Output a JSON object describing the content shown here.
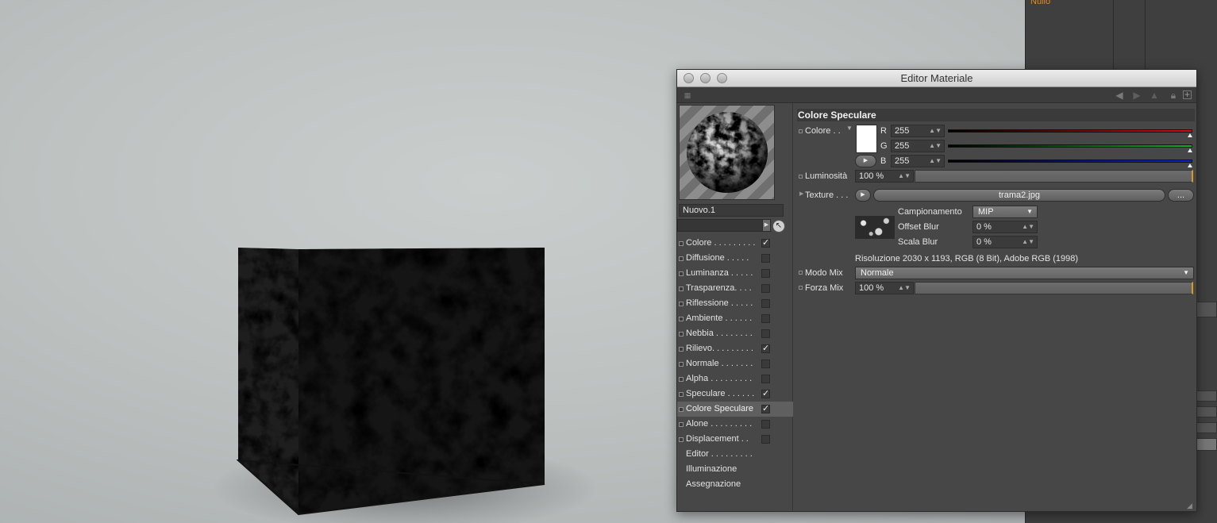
{
  "background_app": {
    "object_name": "Nullo"
  },
  "window": {
    "title": "Editor Materiale"
  },
  "material": {
    "name": "Nuovo.1"
  },
  "channels": [
    {
      "label": "Colore . . . . . . . . .",
      "checked": true
    },
    {
      "label": "Diffusione  . . . . .",
      "checked": false
    },
    {
      "label": "Luminanza . . . . .",
      "checked": false
    },
    {
      "label": "Trasparenza. . . .",
      "checked": false
    },
    {
      "label": "Riflessione . . . . .",
      "checked": false
    },
    {
      "label": "Ambiente . . . . . .",
      "checked": false
    },
    {
      "label": "Nebbia . . . . . . . .",
      "checked": false
    },
    {
      "label": "Rilievo. . . . . . . . .",
      "checked": true
    },
    {
      "label": "Normale . . . . . . .",
      "checked": false
    },
    {
      "label": "Alpha  . . . . . . . . .",
      "checked": false
    },
    {
      "label": "Speculare . . . . . .",
      "checked": true
    },
    {
      "label": "Colore Speculare",
      "checked": true,
      "selected": true
    },
    {
      "label": "Alone  . . . . . . . . .",
      "checked": false
    },
    {
      "label": "Displacement  . .",
      "checked": false
    }
  ],
  "extra_items": [
    {
      "label": "Editor  . . . . . . . . ."
    },
    {
      "label": "Illuminazione"
    },
    {
      "label": "Assegnazione"
    }
  ],
  "section": {
    "title": "Colore Speculare",
    "color_label": "Colore . .",
    "swatch_color": "#ffffff",
    "r_label": "R",
    "g_label": "G",
    "b_label": "B",
    "r": "255",
    "g": "255",
    "b": "255",
    "brightness_label": "Luminosità",
    "brightness": "100 %",
    "brightness_fraction": 1.0,
    "texture_label": "Texture . . .",
    "texture_file": "trama2.jpg",
    "texture_more": "...",
    "sampling_label": "Campionamento",
    "sampling_value": "MIP",
    "offset_blur_label": "Offset Blur",
    "offset_blur": "0 %",
    "scale_blur_label": "Scala Blur",
    "scale_blur": "0 %",
    "resolution": "Risoluzione 2030 x 1193, RGB (8 Bit), Adobe RGB (1998)",
    "mix_mode_label": "Modo Mix",
    "mix_mode": "Normale",
    "mix_strength_label": "Forza Mix",
    "mix_strength": "100 %",
    "mix_strength_fraction": 1.0
  },
  "colors": {
    "accent": "#d69a26",
    "red": "#d01010",
    "green": "#10b020",
    "blue": "#1020d0"
  }
}
